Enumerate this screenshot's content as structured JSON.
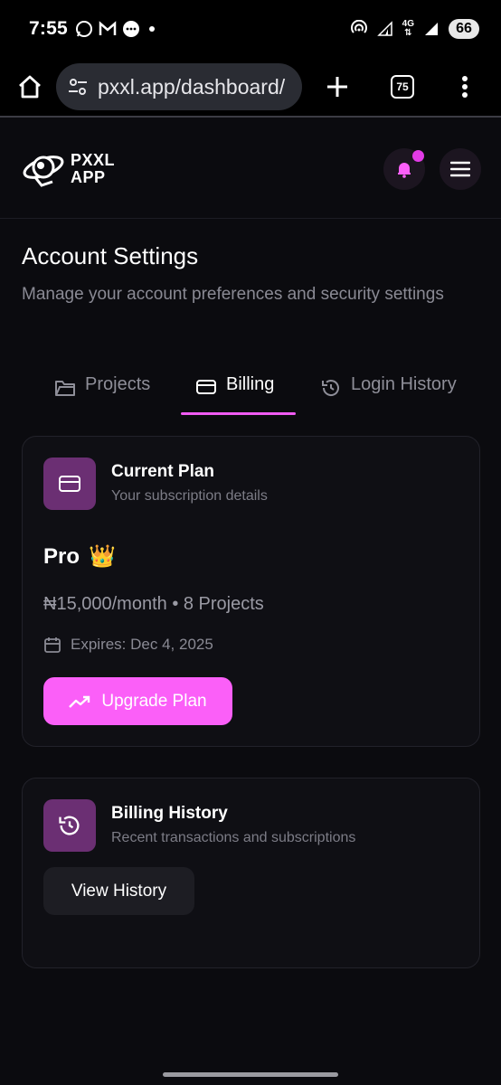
{
  "status_bar": {
    "time": "7:55",
    "network_label": "4G",
    "battery": "66"
  },
  "browser": {
    "url": "pxxl.app/dashboard/",
    "tab_count": "75"
  },
  "app": {
    "logo_line1": "PXXL",
    "logo_line2": "APP",
    "accent_color": "#fb5ff8",
    "notification_dot_color": "#e23be6"
  },
  "page": {
    "title": "Account Settings",
    "subtitle": "Manage your account preferences and security settings"
  },
  "tabs": [
    {
      "label": "Projects",
      "icon": "folder-icon",
      "active": false
    },
    {
      "label": "Billing",
      "icon": "credit-card-icon",
      "active": true
    },
    {
      "label": "Login History",
      "icon": "history-icon",
      "active": false
    }
  ],
  "current_plan": {
    "title": "Current Plan",
    "subtitle": "Your subscription details",
    "plan_name": "Pro",
    "plan_emoji": "👑",
    "price": "₦15,000/month • 8 Projects",
    "expiry": "Expires: Dec 4, 2025",
    "upgrade_label": "Upgrade Plan"
  },
  "billing_history": {
    "title": "Billing History",
    "subtitle": "Recent transactions and subscriptions",
    "button_label": "View History"
  }
}
